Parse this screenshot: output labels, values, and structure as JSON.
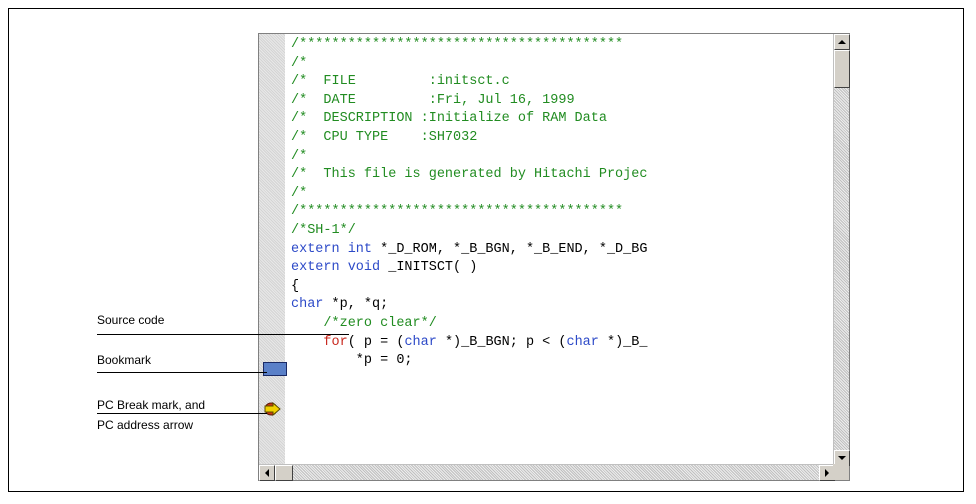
{
  "editor": {
    "lines": [
      [
        {
          "t": "/****************************************",
          "c": "cm"
        }
      ],
      [
        {
          "t": "/*",
          "c": "cm"
        }
      ],
      [
        {
          "t": "/*  FILE         :initsct.c",
          "c": "cm"
        }
      ],
      [
        {
          "t": "/*  DATE         :Fri, Jul 16, 1999",
          "c": "cm"
        }
      ],
      [
        {
          "t": "/*  DESCRIPTION :Initialize of RAM Data",
          "c": "cm"
        }
      ],
      [
        {
          "t": "/*  CPU TYPE    :SH7032",
          "c": "cm"
        }
      ],
      [
        {
          "t": "/*",
          "c": "cm"
        }
      ],
      [
        {
          "t": "/*  This file is generated by Hitachi Projec",
          "c": "cm"
        }
      ],
      [
        {
          "t": "/*",
          "c": "cm"
        }
      ],
      [
        {
          "t": "/****************************************",
          "c": "cm"
        }
      ],
      [
        {
          "t": "/*SH-1*/",
          "c": "cm"
        }
      ],
      [
        {
          "t": "extern int",
          "c": "ty"
        },
        {
          "t": " *_D_ROM, *_B_BGN, *_B_END, *_D_BG",
          "c": "pl"
        }
      ],
      [
        {
          "t": "extern void",
          "c": "ty"
        },
        {
          "t": " _INITSCT( )",
          "c": "pl"
        }
      ],
      [
        {
          "t": "{",
          "c": "pl"
        }
      ],
      [
        {
          "t": "char",
          "c": "ty"
        },
        {
          "t": " *p, *q;",
          "c": "pl"
        }
      ],
      [
        {
          "t": "    /*zero clear*/",
          "c": "cm"
        }
      ],
      [
        {
          "t": "    ",
          "c": "pl"
        },
        {
          "t": "for",
          "c": "kw"
        },
        {
          "t": "( p = (",
          "c": "pl"
        },
        {
          "t": "char",
          "c": "ty"
        },
        {
          "t": " *)_B_BGN; p < (",
          "c": "pl"
        },
        {
          "t": "char",
          "c": "ty"
        },
        {
          "t": " *)_B_",
          "c": "pl"
        }
      ],
      [
        {
          "t": "        *p = 0;",
          "c": "pl"
        }
      ]
    ]
  },
  "callouts": {
    "source_code": "Source code",
    "bookmark": "Bookmark",
    "pc_break_line1": "PC Break mark, and",
    "pc_break_line2": "PC address arrow"
  },
  "icons": {
    "bookmark": "bookmark-icon",
    "pc_break": "pc-break-arrow-icon"
  },
  "colors": {
    "comment": "#218c21",
    "keyword": "#c8281e",
    "type": "#2d4ac8",
    "bookmark": "#5a80c8",
    "pc_arrow": "#f0d000"
  }
}
